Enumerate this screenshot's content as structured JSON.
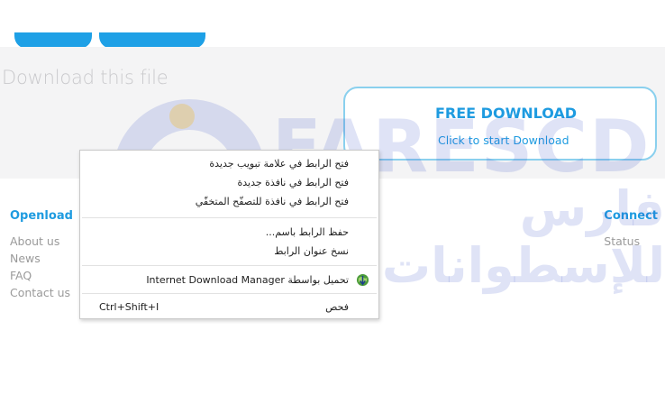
{
  "header": {
    "nav_pills": [
      "",
      ""
    ]
  },
  "download_section": {
    "heading": "Download this file",
    "free_download": {
      "title": "FREE DOWNLOAD",
      "subtitle": "Click to start Download"
    }
  },
  "footer": {
    "left": {
      "title": "Openload",
      "links": [
        "About us",
        "News",
        "FAQ",
        "Contact us"
      ]
    },
    "right": {
      "title": "Connect",
      "links": [
        "Status"
      ]
    }
  },
  "watermark": {
    "latin": "FARESCD",
    "arabic": "فارس للإسطوانات"
  },
  "context_menu": {
    "items": [
      {
        "label": "فتح الرابط في علامة تبويب جديدة"
      },
      {
        "label": "فتح الرابط في نافذة جديدة"
      },
      {
        "label": "فتح الرابط في نافذة للتصفّح المتخفّي"
      },
      {
        "label": "حفظ الرابط باسم..."
      },
      {
        "label": "نسخ عنوان الرابط"
      },
      {
        "label": "تحميل بواسطة Internet Download Manager",
        "icon": "idm-globe-icon"
      },
      {
        "label": "فحص",
        "shortcut": "Ctrl+Shift+I"
      }
    ]
  },
  "colors": {
    "accent": "#1e9be0",
    "box_border": "#8ad0ee",
    "band": "#f4f4f5"
  }
}
